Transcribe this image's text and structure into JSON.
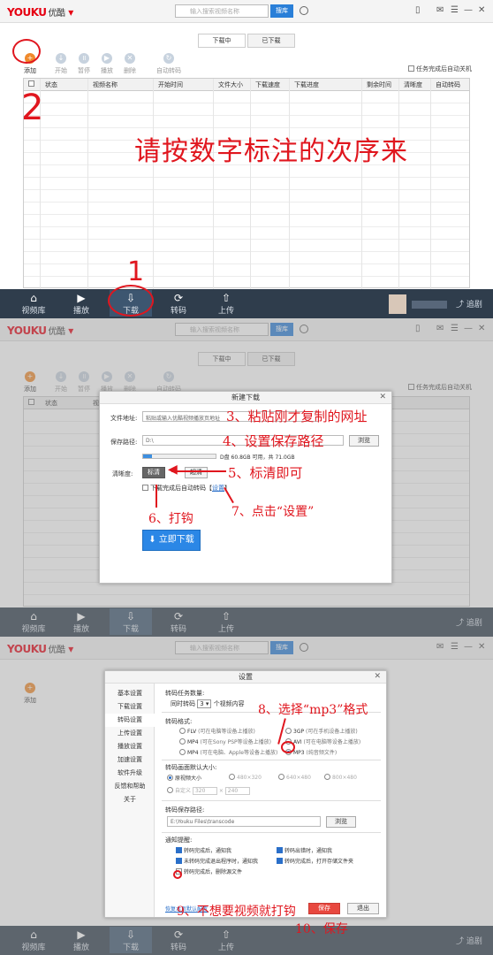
{
  "app": {
    "logo_main": "YOUKU",
    "logo_cn": "优酷",
    "search_placeholder": "输入搜索视频名称",
    "search_button": "搜库"
  },
  "tabs": [
    "下载中",
    "已下载"
  ],
  "toolbar": [
    "添加",
    "开始",
    "暂停",
    "播放",
    "删除",
    "自动转码"
  ],
  "auto_shutdown": "任务完成后自动关机",
  "columns": [
    "状态",
    "视频名称",
    "开始时间",
    "文件大小",
    "下载速度",
    "下载进度",
    "剩余时间",
    "清晰度",
    "自动转码"
  ],
  "bottom_nav": [
    "视频库",
    "播放",
    "下载",
    "转码",
    "上传"
  ],
  "bottom_right": "追剧",
  "annotations": {
    "step1": "1",
    "step2": "2",
    "headline": "请按数字标注的次序来",
    "step3": "3、粘贴刚才复制的网址",
    "step4": "4、设置保存路径",
    "step5": "5、标清即可",
    "step6": "6、打钩",
    "step7": "7、点击“设置”",
    "step8": "8、选择“mp3”格式",
    "step9": "9、不想要视频就打钩",
    "step10": "10、保存"
  },
  "new_download": {
    "title": "新建下载",
    "url_label": "文件地址:",
    "url_placeholder": "粘贴或输入优酷视频播放页地址",
    "path_label": "保存路径:",
    "path_value": "D:\\",
    "browse": "浏览",
    "disk_info": "D盘 60.8GB 可用，共 71.0GB",
    "quality_label": "清晰度:",
    "quality_selected": "标清",
    "quality_other": "超清",
    "auto_transcode_check": "下载完成后自动转码【",
    "settings_link": "设置",
    "settings_close": "】",
    "download_now": "立即下载",
    "progress_fraction": 0.12
  },
  "settings": {
    "title": "设置",
    "side_items": [
      "基本设置",
      "下载设置",
      "转码设置",
      "上传设置",
      "播放设置",
      "加速设置",
      "软件升级",
      "反馈和帮助",
      "关于"
    ],
    "concurrent_label": "转码任务数量:",
    "concurrent_prefix": "同时转码",
    "concurrent_value": "3",
    "concurrent_suffix": "个视频内容",
    "format_label": "转码格式:",
    "formats": [
      {
        "name": "FLV",
        "desc": "(可在电脑等设备上播放)"
      },
      {
        "name": "3GP",
        "desc": "(可在手机设备上播放)"
      },
      {
        "name": "MP4",
        "desc": "(可在Sony PSP等设备上播放)"
      },
      {
        "name": "AVI",
        "desc": "(可在电脑等设备上播放)"
      },
      {
        "name": "MP4",
        "desc": "(可在电脑、Apple等设备上播放)"
      },
      {
        "name": "MP3",
        "desc": "(纯音频文件)"
      }
    ],
    "size_label": "转码画面默认大小:",
    "sizes": [
      "原视频大小",
      "480×320",
      "640×480",
      "800×480"
    ],
    "custom_label": "自定义",
    "custom_w": "320",
    "custom_h": "240",
    "save_path_label": "转码保存路径:",
    "save_path_value": "E:\\Youku Files\\transcode",
    "browse": "浏览",
    "notify_label": "通知提醒:",
    "notify": [
      "转码完成后，通知我",
      "转码出错时，通知我",
      "未转码完成退出程序时，通知我",
      "转码完成后，打开存储文件夹",
      "转码完成后，删除源文件"
    ],
    "restore_link": "恢复本页默认配置",
    "save": "保存",
    "exit": "退出"
  }
}
